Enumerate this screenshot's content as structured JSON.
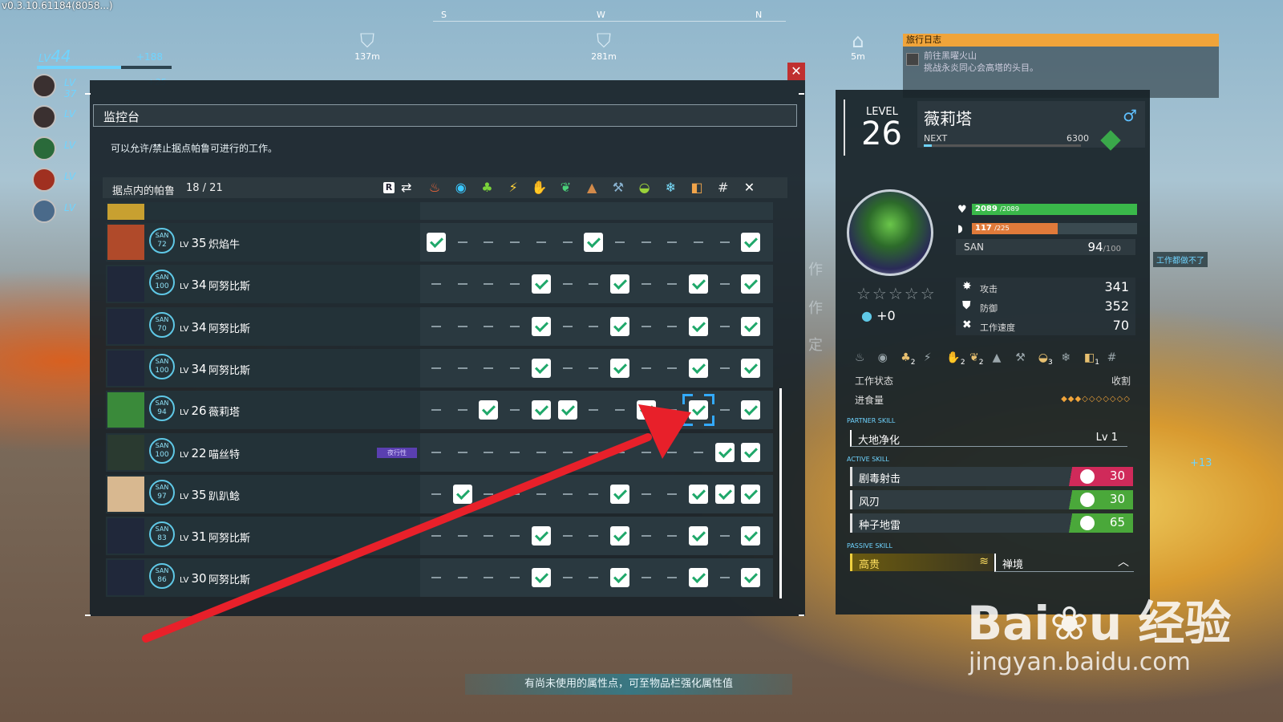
{
  "hud": {
    "version": "v0.3.10.61184(8058...)",
    "player_lv_label": "LV",
    "player_lv": "44",
    "player_exp_gain": "+188",
    "party": [
      {
        "lv": "LV 37",
        "gain": "+25"
      },
      {
        "lv": "LV"
      },
      {
        "lv": "LV"
      },
      {
        "lv": "LV"
      },
      {
        "lv": "LV"
      }
    ],
    "compass": {
      "s": "S",
      "w": "W",
      "n": "N"
    },
    "markers": [
      {
        "distance": "137m",
        "icon": "bird-marker-icon"
      },
      {
        "distance": "281m",
        "icon": "bird-marker-icon"
      },
      {
        "distance": "5m",
        "icon": "base-marker-icon"
      }
    ]
  },
  "travel_log": {
    "title": "旅行日志",
    "line1": "前往黑曜火山",
    "line2": "挑战永炎同心会高塔的头目。"
  },
  "monitor": {
    "title": "监控台",
    "description": "可以允许/禁止据点帕鲁可进行的工作。",
    "list_label": "据点内的帕鲁",
    "count": "18 / 21",
    "r_key": "R",
    "work_icons": [
      {
        "name": "kindling-icon",
        "glyph": "♨",
        "color": "#ff6a3a"
      },
      {
        "name": "watering-icon",
        "glyph": "◉",
        "color": "#3ac8ff"
      },
      {
        "name": "planting-icon",
        "glyph": "♣",
        "color": "#7ad23a"
      },
      {
        "name": "electricity-icon",
        "glyph": "⚡",
        "color": "#ffd23a"
      },
      {
        "name": "handiwork-icon",
        "glyph": "✋",
        "color": "#f2c48a"
      },
      {
        "name": "gathering-icon",
        "glyph": "❦",
        "color": "#4ad27a"
      },
      {
        "name": "lumbering-icon",
        "glyph": "▲",
        "color": "#d28a4a"
      },
      {
        "name": "mining-icon",
        "glyph": "⚒",
        "color": "#8ab4d2"
      },
      {
        "name": "medicine-icon",
        "glyph": "◒",
        "color": "#9ad23a"
      },
      {
        "name": "cooling-icon",
        "glyph": "❄",
        "color": "#7ae0ff"
      },
      {
        "name": "transporting-icon",
        "glyph": "◧",
        "color": "#f0a44a"
      },
      {
        "name": "farming-icon",
        "glyph": "#",
        "color": "#e8e8e8"
      },
      {
        "name": "disable-all-icon",
        "glyph": "✕",
        "color": "#ffffff"
      }
    ],
    "rows": [
      {
        "san": "72",
        "lv": "35",
        "name": "炽焰牛",
        "tag": "",
        "work": [
          1,
          0,
          0,
          0,
          0,
          0,
          1,
          0,
          0,
          0,
          0,
          0,
          1
        ]
      },
      {
        "san": "100",
        "lv": "34",
        "name": "阿努比斯",
        "tag": "",
        "work": [
          0,
          0,
          0,
          0,
          1,
          0,
          0,
          1,
          0,
          0,
          1,
          0,
          1
        ]
      },
      {
        "san": "70",
        "lv": "34",
        "name": "阿努比斯",
        "tag": "",
        "work": [
          0,
          0,
          0,
          0,
          1,
          0,
          0,
          1,
          0,
          0,
          1,
          0,
          1
        ]
      },
      {
        "san": "100",
        "lv": "34",
        "name": "阿努比斯",
        "tag": "",
        "work": [
          0,
          0,
          0,
          0,
          1,
          0,
          0,
          1,
          0,
          0,
          1,
          0,
          1
        ]
      },
      {
        "san": "94",
        "lv": "26",
        "name": "薇莉塔",
        "tag": "",
        "work": [
          0,
          0,
          1,
          0,
          1,
          1,
          0,
          0,
          1,
          0,
          1,
          0,
          1
        ]
      },
      {
        "san": "100",
        "lv": "22",
        "name": "喵丝特",
        "tag": "夜行性",
        "work": [
          0,
          0,
          0,
          0,
          0,
          0,
          0,
          0,
          0,
          0,
          0,
          1,
          1
        ]
      },
      {
        "san": "97",
        "lv": "35",
        "name": "趴趴鲶",
        "tag": "",
        "work": [
          0,
          1,
          0,
          0,
          0,
          0,
          0,
          1,
          0,
          0,
          1,
          1,
          1
        ]
      },
      {
        "san": "83",
        "lv": "31",
        "name": "阿努比斯",
        "tag": "",
        "work": [
          0,
          0,
          0,
          0,
          1,
          0,
          0,
          1,
          0,
          0,
          1,
          0,
          1
        ]
      },
      {
        "san": "86",
        "lv": "30",
        "name": "阿努比斯",
        "tag": "",
        "work": [
          0,
          0,
          0,
          0,
          1,
          0,
          0,
          1,
          0,
          0,
          1,
          0,
          1
        ]
      }
    ]
  },
  "detail": {
    "level_label": "LEVEL",
    "level": "26",
    "name": "薇莉塔",
    "sex_icon": "male-icon",
    "next_label": "NEXT",
    "next_value": "6300",
    "hp": "2089",
    "hp_max": "/2089",
    "hp_fraction": 1.0,
    "food": "117",
    "food_max": "/225",
    "food_fraction": 0.52,
    "san_label": "SAN",
    "san": "94",
    "san_max": "/100",
    "rank_stars": "☆☆☆☆☆",
    "soul_bonus": "+0",
    "attack_label": "攻击",
    "attack": "341",
    "defense_label": "防御",
    "defense": "352",
    "work_speed_label": "工作速度",
    "work_speed": "70",
    "suitability": [
      {
        "name": "kindling-suit-icon",
        "glyph": "♨",
        "level": ""
      },
      {
        "name": "watering-suit-icon",
        "glyph": "◉",
        "level": ""
      },
      {
        "name": "planting-suit-icon",
        "glyph": "♣",
        "level": "2"
      },
      {
        "name": "electricity-suit-icon",
        "glyph": "⚡",
        "level": ""
      },
      {
        "name": "handiwork-suit-icon",
        "glyph": "✋",
        "level": "2"
      },
      {
        "name": "gathering-suit-icon",
        "glyph": "❦",
        "level": "2"
      },
      {
        "name": "lumbering-suit-icon",
        "glyph": "▲",
        "level": ""
      },
      {
        "name": "mining-suit-icon",
        "glyph": "⚒",
        "level": ""
      },
      {
        "name": "medicine-suit-icon",
        "glyph": "◒",
        "level": "3"
      },
      {
        "name": "cooling-suit-icon",
        "glyph": "❄",
        "level": ""
      },
      {
        "name": "transporting-suit-icon",
        "glyph": "◧",
        "level": "1"
      },
      {
        "name": "farming-suit-icon",
        "glyph": "#",
        "level": ""
      }
    ],
    "work_state_label": "工作状态",
    "work_state": "收割",
    "appetite_label": "进食量",
    "appetite_filled": 3,
    "appetite_total": 10,
    "partner_skill_heading": "PARTNER SKILL",
    "partner_skill": "大地净化",
    "partner_skill_lv": "Lv 1",
    "active_skill_heading": "ACTIVE SKILL",
    "active_skills": [
      {
        "name": "剧毒射击",
        "power": "30",
        "element_color": "#d02a5a"
      },
      {
        "name": "风刃",
        "power": "30",
        "element_color": "#4aa83a"
      },
      {
        "name": "种子地雷",
        "power": "65",
        "element_color": "#4aa83a"
      }
    ],
    "passive_skill_heading": "PASSIVE SKILL",
    "passive_skills": [
      {
        "name": "高贵"
      },
      {
        "name": "禅境"
      }
    ]
  },
  "overlay": {
    "notice": "有尚未使用的属性点，可至物品栏强化属性值",
    "side_note": "工作都做不了",
    "side_number": "+13",
    "bg_chars": [
      "作",
      "作",
      "定"
    ],
    "watermark_main": "Bai 经验",
    "watermark_url": "jingyan.baidu.com",
    "close": "✕"
  }
}
